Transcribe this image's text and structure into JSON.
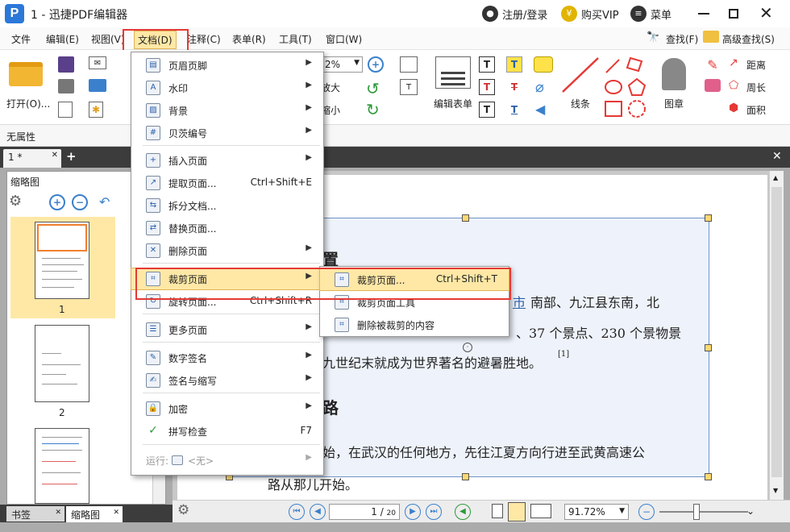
{
  "titlebar": {
    "title": "1 - 迅捷PDF编辑器",
    "logo_letter": "P",
    "login": "注册/登录",
    "vip": "购买VIP",
    "vip_symbol": "¥",
    "menu": "菜单"
  },
  "menubar": {
    "items": [
      "文件",
      "编辑(E)",
      "视图(V)",
      "文档(D)",
      "注释(C)",
      "表单(R)",
      "工具(T)",
      "窗口(W)"
    ],
    "find": "查找(F)",
    "advanced_find": "高级查找(S)"
  },
  "toolbar": {
    "open": "打开(O)...",
    "zoom_value": "2%",
    "zoom_in": "放大",
    "zoom_out": "缩小",
    "edit_form": "编辑表单",
    "line": "线条",
    "stamp": "图章",
    "distance": "距离",
    "perimeter": "周长",
    "area": "面积"
  },
  "propbar": {
    "label": "无属性"
  },
  "tabs": {
    "doc_tab": "1 *",
    "add": "+"
  },
  "leftpanel": {
    "title": "缩略图",
    "pages": [
      "1",
      "2"
    ],
    "bookmarks_tab": "书签",
    "thumbs_tab": "缩略图"
  },
  "document": {
    "heading1": "置",
    "line1_link": "市",
    "line1": "南部、九江县东南，北",
    "line2": "、37 个景点、230 个景物景",
    "line3": "九世纪末就成为世界著名的避暑胜地。",
    "footnote": "[1]",
    "heading2": "路",
    "line4": "始，在武汉的任何地方，先往江夏方向行进至武黄高速公",
    "line5": "路从那儿开始。"
  },
  "status": {
    "page_current": "1",
    "page_total": "20",
    "zoom": "91.72%"
  },
  "menu": {
    "items": [
      {
        "label": "页眉页脚",
        "shortcut": "",
        "arrow": true
      },
      {
        "label": "水印",
        "shortcut": "",
        "arrow": true
      },
      {
        "label": "背景",
        "shortcut": "",
        "arrow": true
      },
      {
        "label": "贝茨编号",
        "shortcut": "",
        "arrow": true
      },
      {
        "label": "插入页面",
        "shortcut": "",
        "arrow": true
      },
      {
        "label": "提取页面...",
        "shortcut": "Ctrl+Shift+E",
        "arrow": false
      },
      {
        "label": "拆分文档...",
        "shortcut": "",
        "arrow": false
      },
      {
        "label": "替换页面...",
        "shortcut": "",
        "arrow": false
      },
      {
        "label": "删除页面",
        "shortcut": "",
        "arrow": true
      },
      {
        "label": "裁剪页面",
        "shortcut": "",
        "arrow": true
      },
      {
        "label": "旋转页面...",
        "shortcut": "Ctrl+Shift+R",
        "arrow": false
      },
      {
        "label": "更多页面",
        "shortcut": "",
        "arrow": true
      },
      {
        "label": "数字签名",
        "shortcut": "",
        "arrow": true
      },
      {
        "label": "签名与缩写",
        "shortcut": "",
        "arrow": true
      },
      {
        "label": "加密",
        "shortcut": "",
        "arrow": true
      },
      {
        "label": "拼写检查",
        "shortcut": "F7",
        "arrow": false
      },
      {
        "label": "运行:",
        "value": "<无>",
        "shortcut": "",
        "arrow": true
      }
    ]
  },
  "submenu": {
    "items": [
      {
        "label": "裁剪页面...",
        "shortcut": "Ctrl+Shift+T"
      },
      {
        "label": "裁剪页面工具",
        "shortcut": ""
      },
      {
        "label": "删除被裁剪的内容",
        "shortcut": ""
      }
    ]
  },
  "colors": {
    "accent": "#2b78d8",
    "highlight": "#ffe8a6",
    "annotation_red": "#e53935",
    "crop_fill": "#eef3fb"
  }
}
